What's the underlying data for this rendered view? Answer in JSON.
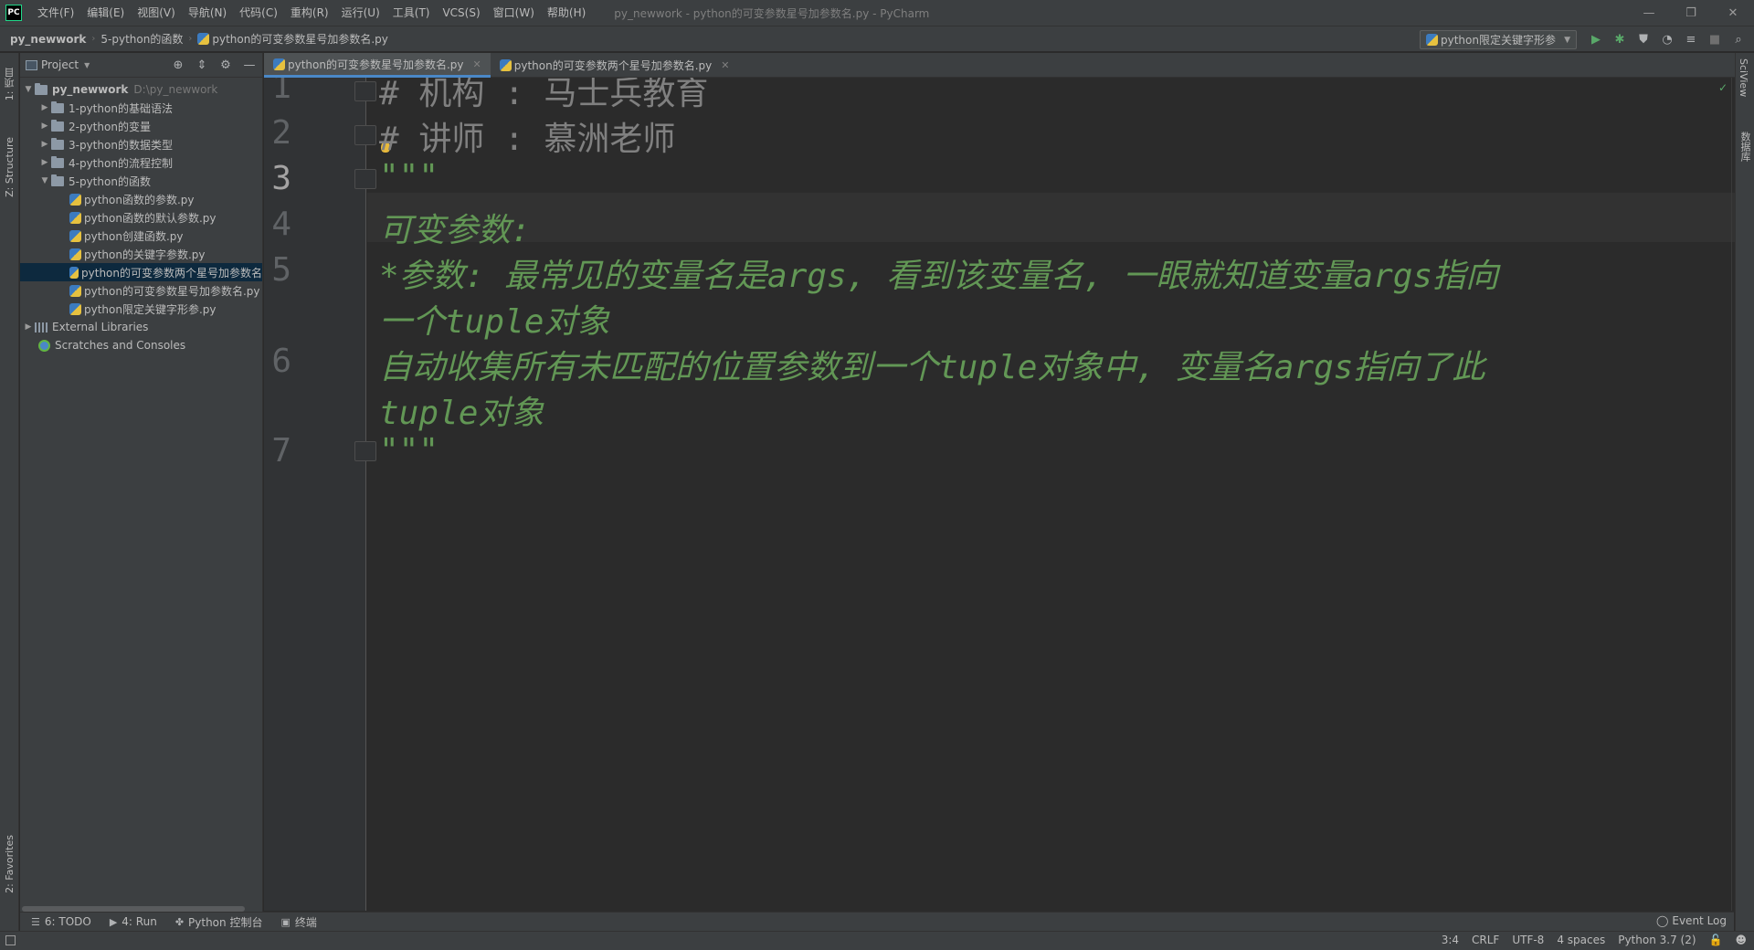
{
  "window": {
    "app_logo": "PC",
    "title": "py_newwork - python的可变参数星号加参数名.py - PyCharm",
    "minimize": "—",
    "maximize": "❐",
    "close": "✕"
  },
  "menu": [
    "文件(F)",
    "编辑(E)",
    "视图(V)",
    "导航(N)",
    "代码(C)",
    "重构(R)",
    "运行(U)",
    "工具(T)",
    "VCS(S)",
    "窗口(W)",
    "帮助(H)"
  ],
  "breadcrumb": {
    "project": "py_newwork",
    "folder": "5-python的函数",
    "file": "python的可变参数星号加参数名.py"
  },
  "run_config": {
    "name": "python限定关键字形参"
  },
  "left_strip": {
    "project_tab": "1: 项目",
    "structure_tab": "Z: Structure",
    "favorites_tab": "2: Favorites"
  },
  "right_strip": {
    "sciview_tab": "SciView",
    "database_tab": "数据库"
  },
  "project_panel": {
    "title": "Project",
    "tree": [
      {
        "label": "py_newwork",
        "hint": "D:\\py_newwork",
        "type": "root"
      },
      {
        "label": "1-python的基础语法",
        "type": "folder"
      },
      {
        "label": "2-python的变量",
        "type": "folder"
      },
      {
        "label": "3-python的数据类型",
        "type": "folder"
      },
      {
        "label": "4-python的流程控制",
        "type": "folder"
      },
      {
        "label": "5-python的函数",
        "type": "folder-open"
      },
      {
        "label": "python函数的参数.py",
        "type": "file"
      },
      {
        "label": "python函数的默认参数.py",
        "type": "file"
      },
      {
        "label": "python创建函数.py",
        "type": "file"
      },
      {
        "label": "python的关键字参数.py",
        "type": "file"
      },
      {
        "label": "python的可变参数两个星号加参数名",
        "type": "file",
        "selected": true
      },
      {
        "label": "python的可变参数星号加参数名.py",
        "type": "file"
      },
      {
        "label": "python限定关键字形参.py",
        "type": "file"
      },
      {
        "label": "External Libraries",
        "type": "lib"
      },
      {
        "label": "Scratches and Consoles",
        "type": "scratch"
      }
    ]
  },
  "editor_tabs": [
    {
      "label": "python的可变参数星号加参数名.py",
      "active": true
    },
    {
      "label": "python的可变参数两个星号加参数名.py",
      "active": false
    }
  ],
  "editor": {
    "line_numbers": [
      "1",
      "2",
      "3",
      "4",
      "5",
      "6",
      "7"
    ],
    "lines": [
      "# 机构 : 马士兵教育",
      "# 讲师 :  慕洲老师",
      "\"\"\"",
      "可变参数:",
      "    *参数: 最常见的变量名是args, 看到该变量名, 一眼就知道变量args指向",
      " 一个tuple对象",
      "    自动收集所有未匹配的位置参数到一个tuple对象中, 变量名args指向了此",
      "tuple对象",
      "\"\"\""
    ]
  },
  "bottom_tools": [
    {
      "icon": "☰",
      "label": "6: TODO"
    },
    {
      "icon": "▶",
      "label": "4: Run"
    },
    {
      "icon": "✤",
      "label": "Python 控制台"
    },
    {
      "icon": "▣",
      "label": "终端"
    }
  ],
  "event_log": "Event Log",
  "status": {
    "position": "3:4",
    "line_sep": "CRLF",
    "encoding": "UTF-8",
    "indent": "4 spaces",
    "interpreter": "Python 3.7 (2)"
  }
}
